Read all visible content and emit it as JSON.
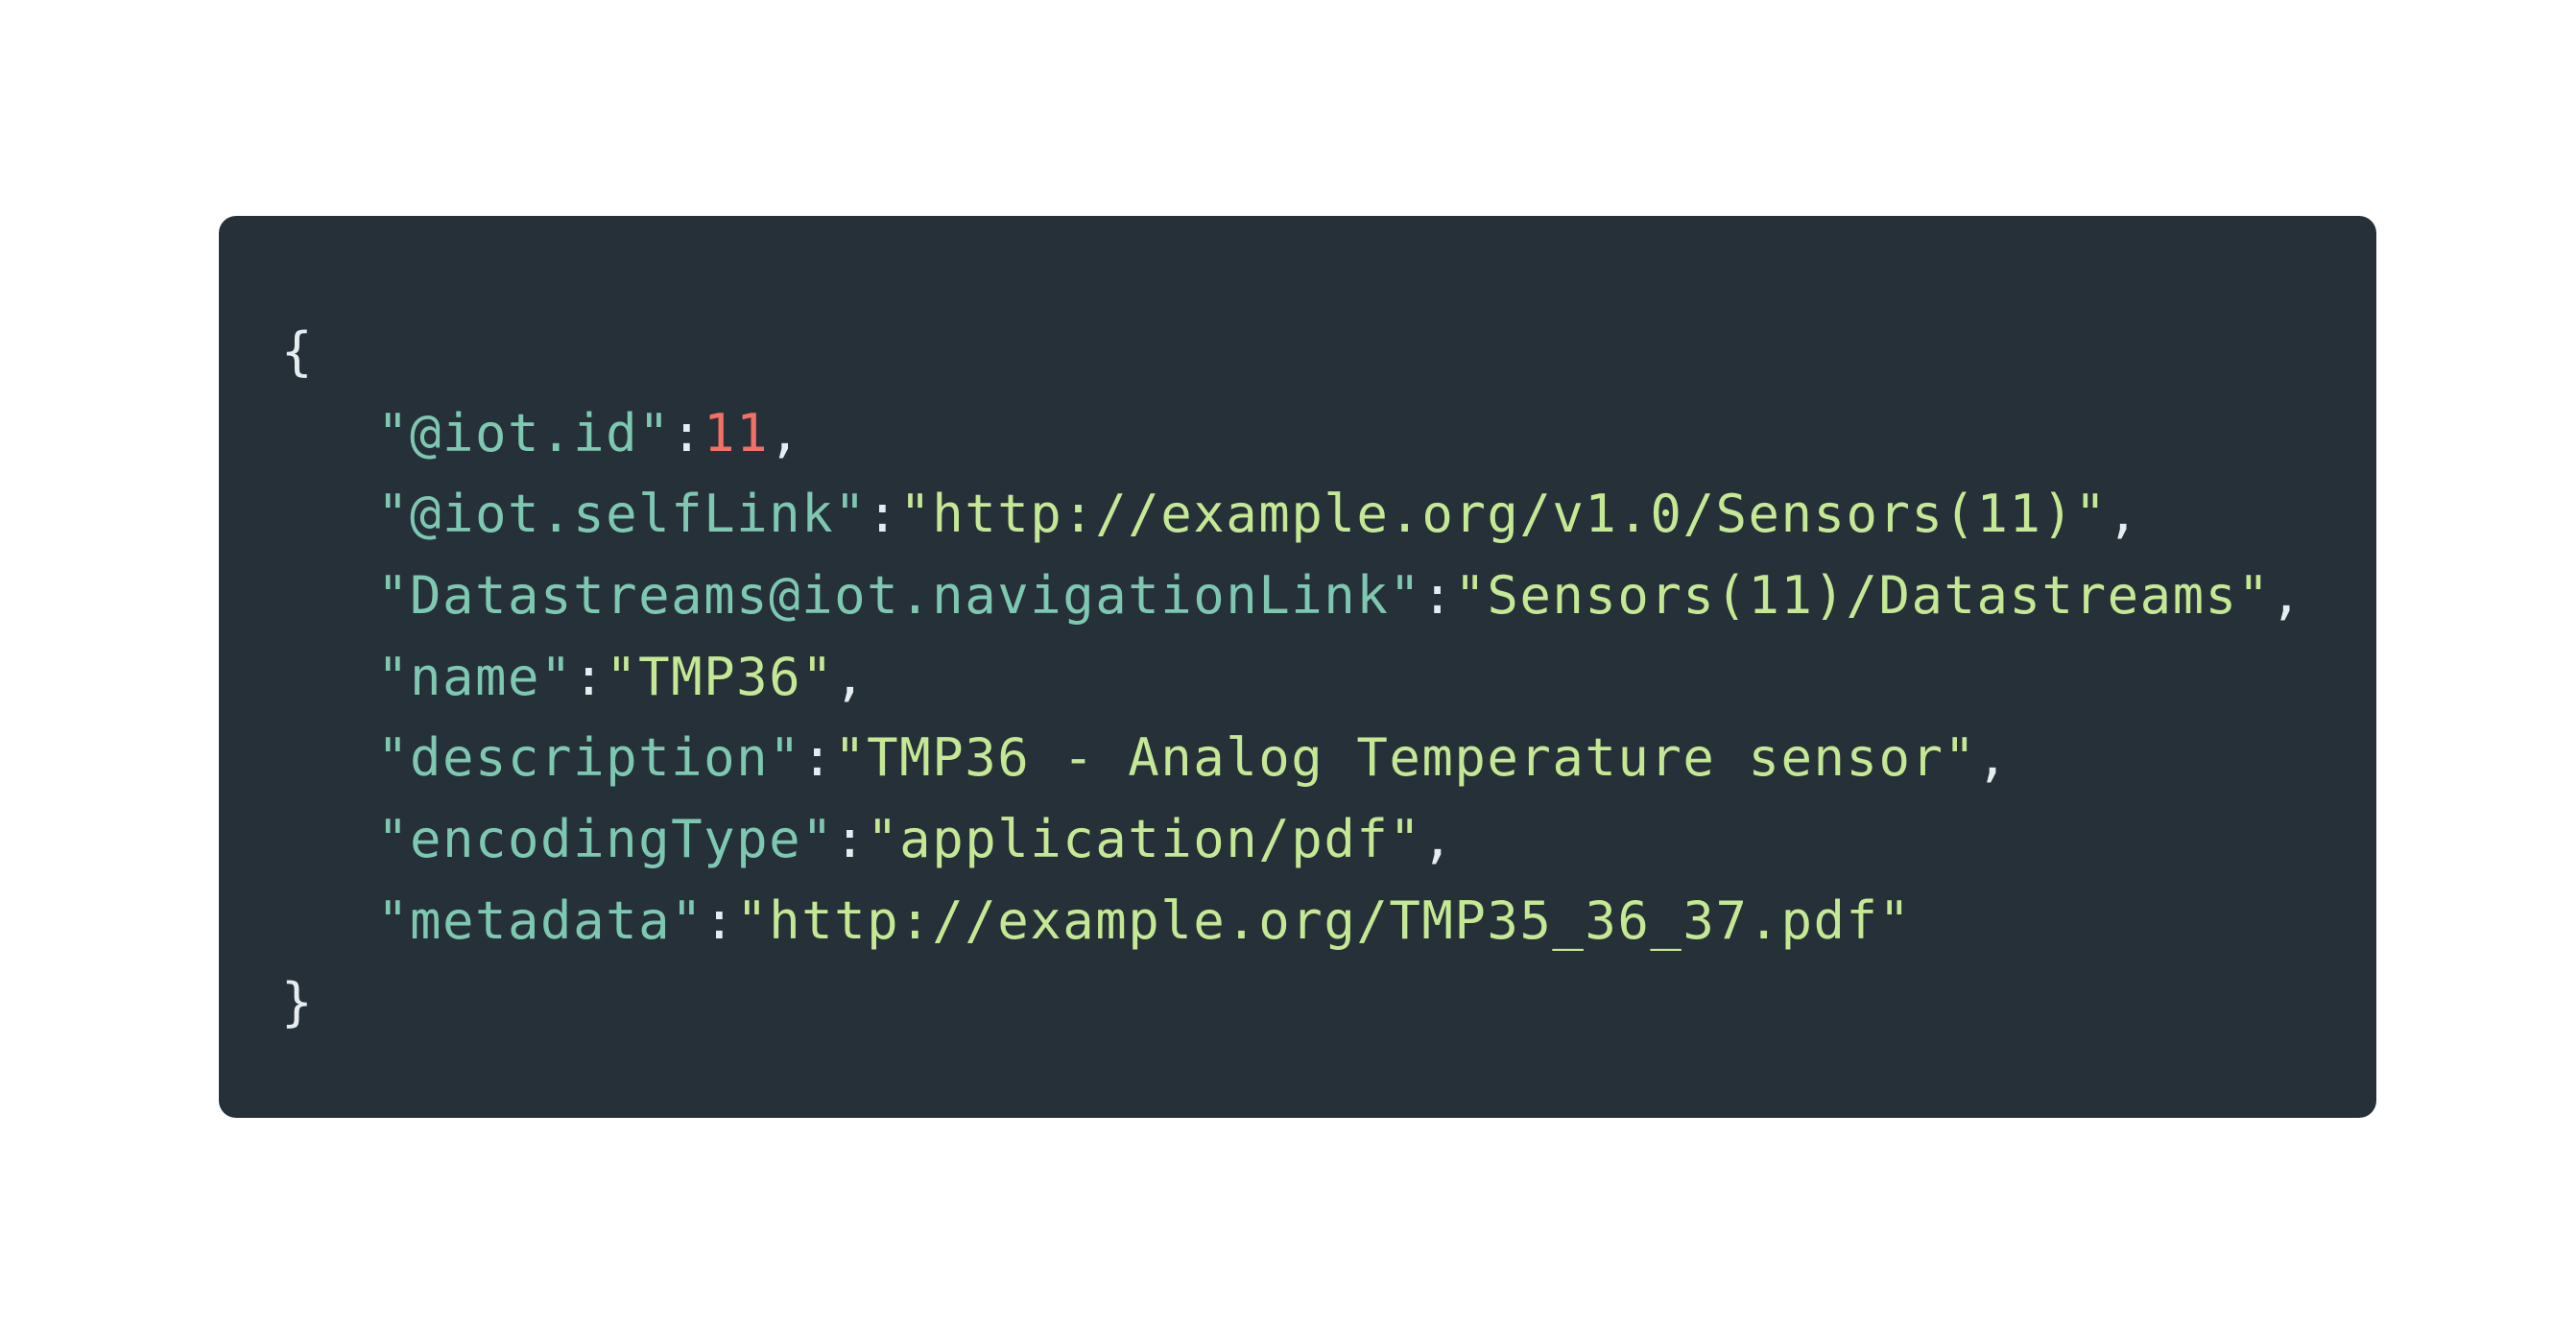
{
  "code": {
    "open_brace": "{",
    "close_brace": "}",
    "colon": ":",
    "comma": ",",
    "entries": [
      {
        "key": "\"@iot.id\"",
        "value": "11",
        "value_type": "number",
        "trailing": ","
      },
      {
        "key": "\"@iot.selfLink\"",
        "value": "\"http://example.org/v1.0/Sensors(11)\"",
        "value_type": "string",
        "trailing": ","
      },
      {
        "key": "\"Datastreams@iot.navigationLink\"",
        "value": "\"Sensors(11)/Datastreams\"",
        "value_type": "string",
        "trailing": ","
      },
      {
        "key": "\"name\"",
        "value": "\"TMP36\"",
        "value_type": "string",
        "trailing": ","
      },
      {
        "key": "\"description\"",
        "value": "\"TMP36 - Analog Temperature sensor\"",
        "value_type": "string",
        "trailing": ","
      },
      {
        "key": "\"encodingType\"",
        "value": "\"application/pdf\"",
        "value_type": "string",
        "trailing": ","
      },
      {
        "key": "\"metadata\"",
        "value": "\"http://example.org/TMP35_36_37.pdf\"",
        "value_type": "string",
        "trailing": ""
      }
    ]
  },
  "colors": {
    "background": "#263038",
    "key": "#7ec8b2",
    "string": "#c5e894",
    "number": "#f37164",
    "punctuation": "#e6edf0"
  }
}
